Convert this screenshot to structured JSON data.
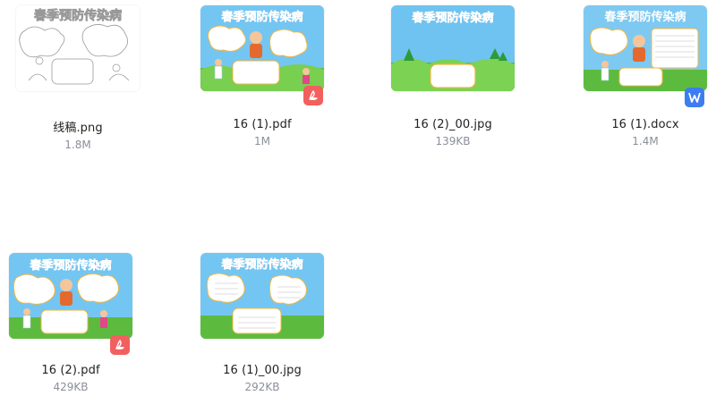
{
  "files": [
    {
      "name": "线稿.png",
      "size": "1.8M",
      "thumb_title": "春季预防传染病",
      "type": "png",
      "badge": ""
    },
    {
      "name": "16 (1).pdf",
      "size": "1M",
      "thumb_title": "春季预防传染病",
      "type": "pdf",
      "badge": "pdf-icon"
    },
    {
      "name": "16 (2)_00.jpg",
      "size": "139KB",
      "thumb_title": "春季预防传染病",
      "type": "jpg",
      "badge": ""
    },
    {
      "name": "16 (1).docx",
      "size": "1.4M",
      "thumb_title": "春季预防传染病",
      "type": "docx",
      "badge": "word-icon"
    },
    {
      "name": "16 (2).pdf",
      "size": "429KB",
      "thumb_title": "春季预防传染病",
      "type": "pdf",
      "badge": "pdf-icon"
    },
    {
      "name": "16 (1)_00.jpg",
      "size": "292KB",
      "thumb_title": "春季预防传染病",
      "type": "jpg",
      "badge": ""
    }
  ],
  "colors": {
    "pdf_badge": "#f1605f",
    "word_badge": "#3d7df0",
    "sky": "#74c6f2",
    "grass": "#5cbb3f",
    "title": "#e85a2a"
  }
}
